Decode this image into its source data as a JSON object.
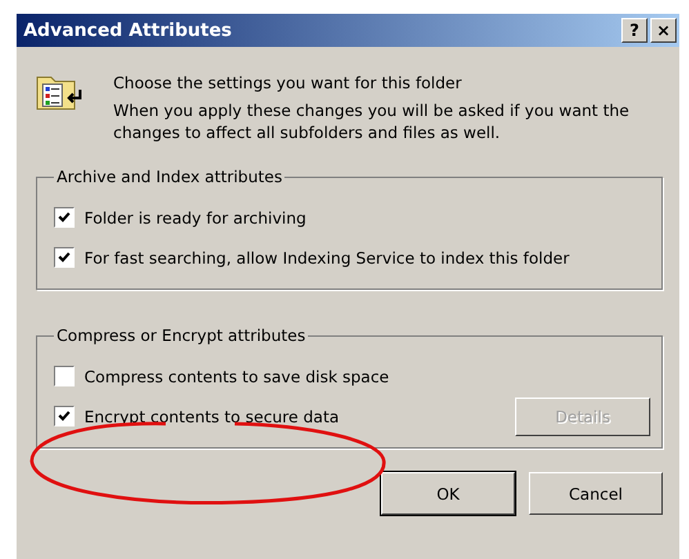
{
  "window": {
    "title": "Advanced Attributes",
    "title_buttons": [
      "?",
      "×"
    ]
  },
  "header": {
    "title": "Choose the settings you want for this folder",
    "text": "When you apply these changes you will be asked if you want the changes to affect all subfolders and files as well."
  },
  "groups": [
    {
      "label": "Archive and Index attributes",
      "options": [
        {
          "label": "Folder is ready for archiving",
          "checked": true
        },
        {
          "label": "For fast searching, allow Indexing Service to index this folder",
          "checked": true
        }
      ]
    },
    {
      "label": "Compress or Encrypt attributes",
      "options": [
        {
          "label": "Compress contents to save disk space",
          "checked": false
        },
        {
          "label": "Encrypt contents to secure data",
          "checked": true
        }
      ],
      "button": {
        "label": "Details",
        "disabled": true
      }
    }
  ],
  "annotation": {
    "kind": "ellipse"
  },
  "buttons": [
    "OK",
    "Cancel"
  ]
}
